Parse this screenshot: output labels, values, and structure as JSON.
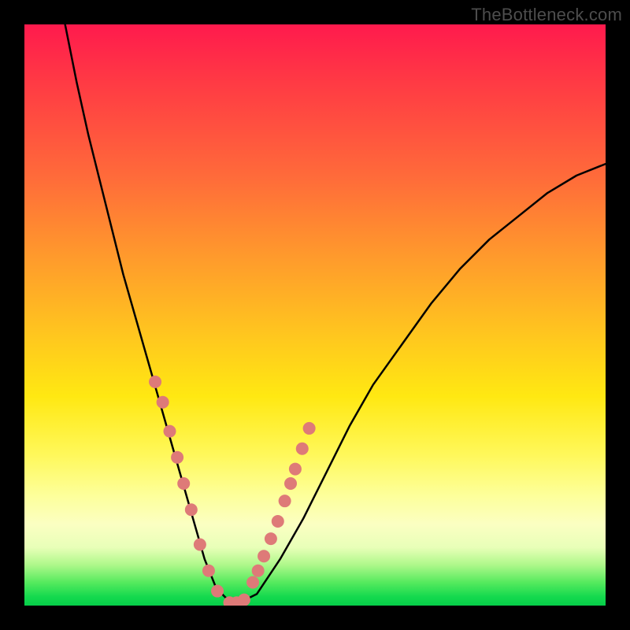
{
  "watermark": "TheBottleneck.com",
  "chart_data": {
    "type": "line",
    "title": "",
    "xlabel": "",
    "ylabel": "",
    "xlim": [
      0,
      100
    ],
    "ylim": [
      0,
      100
    ],
    "grid": false,
    "legend": false,
    "background": {
      "type": "vertical-gradient",
      "stops": [
        {
          "pos": 0.0,
          "color": "#ff1a4d"
        },
        {
          "pos": 0.1,
          "color": "#ff3a44"
        },
        {
          "pos": 0.26,
          "color": "#ff6a3a"
        },
        {
          "pos": 0.4,
          "color": "#ff9a2c"
        },
        {
          "pos": 0.54,
          "color": "#ffc81e"
        },
        {
          "pos": 0.64,
          "color": "#ffe812"
        },
        {
          "pos": 0.74,
          "color": "#fff85a"
        },
        {
          "pos": 0.81,
          "color": "#fdff9a"
        },
        {
          "pos": 0.86,
          "color": "#fbffc2"
        },
        {
          "pos": 0.9,
          "color": "#e8ffb8"
        },
        {
          "pos": 0.93,
          "color": "#aef88a"
        },
        {
          "pos": 0.96,
          "color": "#56ea5e"
        },
        {
          "pos": 0.985,
          "color": "#14d94e"
        },
        {
          "pos": 1.0,
          "color": "#06cf49"
        }
      ]
    },
    "series": [
      {
        "name": "curve",
        "color": "#000000",
        "stroke_width": 2.5,
        "type": "line",
        "x": [
          7,
          9,
          11,
          13,
          15,
          17,
          19,
          21,
          23,
          25,
          27,
          29,
          31,
          33,
          36,
          40,
          44,
          48,
          52,
          56,
          60,
          65,
          70,
          75,
          80,
          85,
          90,
          95,
          100
        ],
        "y": [
          100,
          90,
          81,
          73,
          65,
          57,
          50,
          43,
          36,
          29,
          22,
          15,
          8,
          3,
          0,
          2,
          8,
          15,
          23,
          31,
          38,
          45,
          52,
          58,
          63,
          67,
          71,
          74,
          76
        ]
      },
      {
        "name": "markers",
        "color": "#de7a78",
        "type": "scatter",
        "marker_radius": 8,
        "x": [
          22.5,
          23.8,
          25.0,
          26.3,
          27.4,
          28.7,
          30.2,
          31.7,
          33.2,
          35.3,
          36.5,
          37.8,
          39.3,
          40.2,
          41.2,
          42.4,
          43.6,
          44.8,
          45.8,
          46.6,
          47.8,
          49.0
        ],
        "y": [
          38.5,
          35.0,
          30.0,
          25.5,
          21.0,
          16.5,
          10.5,
          6.0,
          2.5,
          0.5,
          0.5,
          1.0,
          4.0,
          6.0,
          8.5,
          11.5,
          14.5,
          18.0,
          21.0,
          23.5,
          27.0,
          30.5
        ]
      }
    ]
  }
}
